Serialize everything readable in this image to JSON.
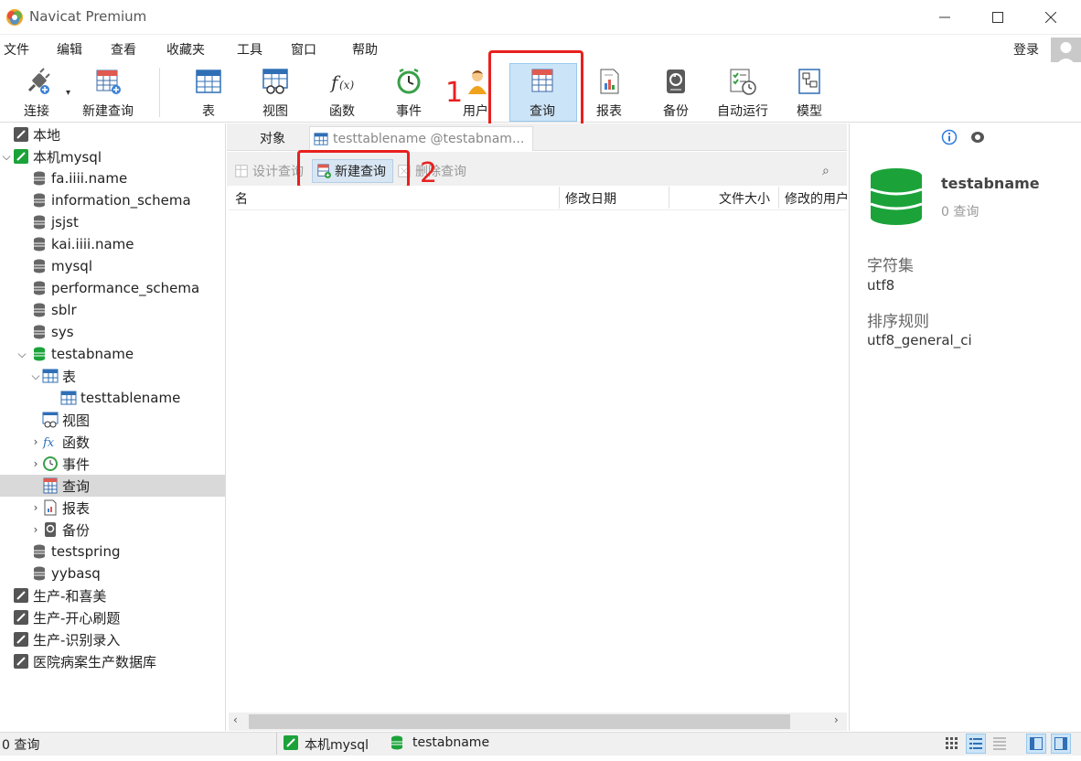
{
  "window": {
    "title": "Navicat Premium"
  },
  "menu": [
    "文件",
    "编辑",
    "查看",
    "收藏夹",
    "工具",
    "窗口",
    "帮助"
  ],
  "login_label": "登录",
  "toolbar": {
    "connect": "连接",
    "new_query": "新建查询",
    "table": "表",
    "view": "视图",
    "function": "函数",
    "event": "事件",
    "user": "用户",
    "query": "查询",
    "report": "报表",
    "backup": "备份",
    "automation": "自动运行",
    "model": "模型"
  },
  "annotations": {
    "step1": "1",
    "step2": "2"
  },
  "tree": {
    "local": "本地",
    "conn": "本机mysql",
    "dbs": [
      "fa.iiii.name",
      "information_schema",
      "jsjst",
      "kai.iiii.name",
      "mysql",
      "performance_schema",
      "sblr",
      "sys"
    ],
    "open_db": "testabname",
    "table_group": "表",
    "table_item": "testtablename",
    "view_group": "视图",
    "function_group": "函数",
    "event_group": "事件",
    "query_group": "查询",
    "report_group": "报表",
    "backup_group": "备份",
    "more_dbs": [
      "testspring",
      "yybasq"
    ],
    "other_conns": [
      "生产-和喜美",
      "生产-开心刷题",
      "生产-识别录入",
      "医院病案生产数据库"
    ]
  },
  "tabs": {
    "objects": "对象",
    "query_tab": "testtablename @testabnam..."
  },
  "obj_toolbar": {
    "design": "设计查询",
    "new": "新建查询",
    "delete": "删除查询"
  },
  "columns": {
    "name": "名",
    "modified": "修改日期",
    "size": "文件大小",
    "user": "修改的用户"
  },
  "info": {
    "db_name": "testabname",
    "count": "0 查询",
    "charset_label": "字符集",
    "charset": "utf8",
    "collation_label": "排序规则",
    "collation": "utf8_general_ci"
  },
  "status": {
    "count": "0 查询",
    "conn": "本机mysql",
    "db": "testabname"
  },
  "colors": {
    "db_green": "#1ba33a",
    "accent_blue": "#cce4f7",
    "annotation_red": "#e8201e"
  }
}
